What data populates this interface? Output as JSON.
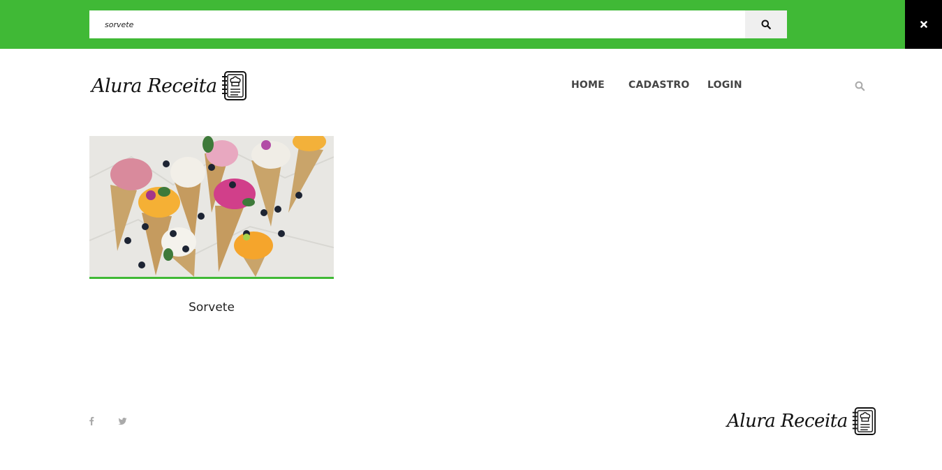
{
  "search": {
    "value": "sorvete",
    "button_icon": "search-icon"
  },
  "close_icon": "close-icon",
  "header": {
    "logo_text": "Alura Receita",
    "logo_icon": "recipe-book-icon",
    "nav": [
      {
        "label": "HOME"
      },
      {
        "label": "CADASTRO"
      },
      {
        "label": "LOGIN"
      }
    ],
    "search_icon": "search-icon"
  },
  "results": [
    {
      "title": "Sorvete",
      "image": "ice-cream-cones-photo"
    }
  ],
  "footer": {
    "social": [
      "facebook-icon",
      "twitter-icon"
    ],
    "logo_text": "Alura Receita"
  },
  "colors": {
    "accent": "#40b936",
    "close_bg": "#000000",
    "nav_text": "#444444",
    "icon_gray": "#aaaaaa"
  }
}
